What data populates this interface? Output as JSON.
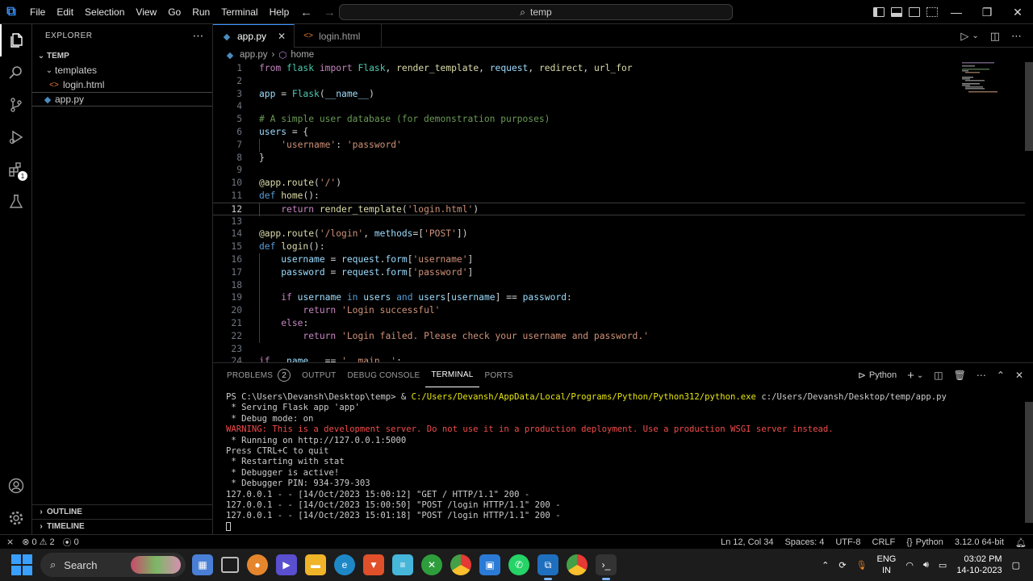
{
  "titlebar": {
    "menu": [
      "File",
      "Edit",
      "Selection",
      "View",
      "Go",
      "Run",
      "Terminal",
      "Help"
    ],
    "search_text": "temp"
  },
  "sidebar": {
    "title": "EXPLORER",
    "root": "TEMP",
    "items": [
      {
        "label": "templates",
        "type": "folder"
      },
      {
        "label": "login.html",
        "type": "html"
      },
      {
        "label": "app.py",
        "type": "py"
      }
    ],
    "outline": "OUTLINE",
    "timeline": "TIMELINE"
  },
  "tabs": [
    {
      "label": "app.py",
      "active": true
    },
    {
      "label": "login.html",
      "active": false
    }
  ],
  "breadcrumb": {
    "file": "app.py",
    "symbol": "home"
  },
  "code": [
    {
      "n": "1",
      "html": "<span class='kw'>from</span> <span class='cls'>flask</span> <span class='kw'>import</span> <span class='cls'>Flask</span>, <span class='fn'>render_template</span>, <span class='var'>request</span>, <span class='fn'>redirect</span>, <span class='fn'>url_for</span>"
    },
    {
      "n": "2",
      "html": ""
    },
    {
      "n": "3",
      "html": "<span class='var'>app</span> = <span class='cls'>Flask</span>(<span class='var'>__name__</span>)"
    },
    {
      "n": "4",
      "html": ""
    },
    {
      "n": "5",
      "html": "<span class='cm'># A simple user database (for demonstration purposes)</span>"
    },
    {
      "n": "6",
      "html": "<span class='var'>users</span> = {"
    },
    {
      "n": "7",
      "html": "    <span class='str'>'username'</span>: <span class='str'>'password'</span>",
      "guide": true
    },
    {
      "n": "8",
      "html": "}"
    },
    {
      "n": "9",
      "html": ""
    },
    {
      "n": "10",
      "html": "<span class='dec'>@app.route</span>(<span class='str'>'/'</span>)"
    },
    {
      "n": "11",
      "html": "<span class='kb'>def</span> <span class='fn'>home</span>():"
    },
    {
      "n": "12",
      "html": "    <span class='kw'>return</span> <span class='fn'>render_template</span>(<span class='str'>'login.html'</span>)",
      "current": true,
      "guide": true
    },
    {
      "n": "13",
      "html": ""
    },
    {
      "n": "14",
      "html": "<span class='dec'>@app.route</span>(<span class='str'>'/login'</span>, <span class='var'>methods</span>=[<span class='str'>'POST'</span>])"
    },
    {
      "n": "15",
      "html": "<span class='kb'>def</span> <span class='fn'>login</span>():"
    },
    {
      "n": "16",
      "html": "    <span class='var'>username</span> = <span class='var'>request</span>.<span class='var'>form</span>[<span class='str'>'username'</span>]",
      "guide": true
    },
    {
      "n": "17",
      "html": "    <span class='var'>password</span> = <span class='var'>request</span>.<span class='var'>form</span>[<span class='str'>'password'</span>]",
      "guide": true
    },
    {
      "n": "18",
      "html": "",
      "guide": true
    },
    {
      "n": "19",
      "html": "    <span class='kw'>if</span> <span class='var'>username</span> <span class='kb'>in</span> <span class='var'>users</span> <span class='kb'>and</span> <span class='var'>users</span>[<span class='var'>username</span>] == <span class='var'>password</span>:",
      "guide": true
    },
    {
      "n": "20",
      "html": "        <span class='kw'>return</span> <span class='str'>'Login successful'</span>",
      "guide": true
    },
    {
      "n": "21",
      "html": "    <span class='kw'>else</span>:",
      "guide": true
    },
    {
      "n": "22",
      "html": "        <span class='kw'>return</span> <span class='str'>'Login failed. Please check your username and password.'</span>",
      "guide": true
    },
    {
      "n": "23",
      "html": ""
    },
    {
      "n": "24",
      "html": "<span class='kw'>if</span> <span class='var'>__name__</span> == <span class='str'>'__main__'</span>:"
    }
  ],
  "panel": {
    "tabs": [
      "PROBLEMS",
      "OUTPUT",
      "DEBUG CONSOLE",
      "TERMINAL",
      "PORTS"
    ],
    "problems_count": "2",
    "active_tab": "TERMINAL",
    "shell": "Python"
  },
  "terminal": {
    "prompt_path": "PS C:\\Users\\Devansh\\Desktop\\temp> & ",
    "exe_path": "C:/Users/Devansh/AppData/Local/Programs/Python/Python312/python.exe",
    "script_path": " c:/Users/Devansh/Desktop/temp/app.py",
    "lines": [
      {
        "text": " * Serving Flask app 'app'",
        "kind": "normal"
      },
      {
        "text": " * Debug mode: on",
        "kind": "normal"
      },
      {
        "text": "WARNING: This is a development server. Do not use it in a production deployment. Use a production WSGI server instead.",
        "kind": "warn"
      },
      {
        "text": " * Running on http://127.0.0.1:5000",
        "kind": "normal"
      },
      {
        "text": "Press CTRL+C to quit",
        "kind": "normal"
      },
      {
        "text": " * Restarting with stat",
        "kind": "normal"
      },
      {
        "text": " * Debugger is active!",
        "kind": "normal"
      },
      {
        "text": " * Debugger PIN: 934-379-303",
        "kind": "normal"
      },
      {
        "text": "127.0.0.1 - - [14/Oct/2023 15:00:12] \"GET / HTTP/1.1\" 200 -",
        "kind": "normal"
      },
      {
        "text": "127.0.0.1 - - [14/Oct/2023 15:00:50] \"POST /login HTTP/1.1\" 200 -",
        "kind": "normal"
      },
      {
        "text": "127.0.0.1 - - [14/Oct/2023 15:01:18] \"POST /login HTTP/1.1\" 200 -",
        "kind": "normal"
      }
    ]
  },
  "statusbar": {
    "errors": "0",
    "warnings": "2",
    "ports": "0",
    "position": "Ln 12, Col 34",
    "spaces": "Spaces: 4",
    "encoding": "UTF-8",
    "eol": "CRLF",
    "language": "Python",
    "interpreter": "3.12.0 64-bit"
  },
  "taskbar": {
    "search_label": "Search",
    "lang_top": "ENG",
    "lang_bottom": "IN",
    "time": "03:02 PM",
    "date": "14-10-2023"
  },
  "colors": {
    "accent": "#3794ff",
    "warning_text": "#f14c4c",
    "exe_path": "#e5e510"
  }
}
